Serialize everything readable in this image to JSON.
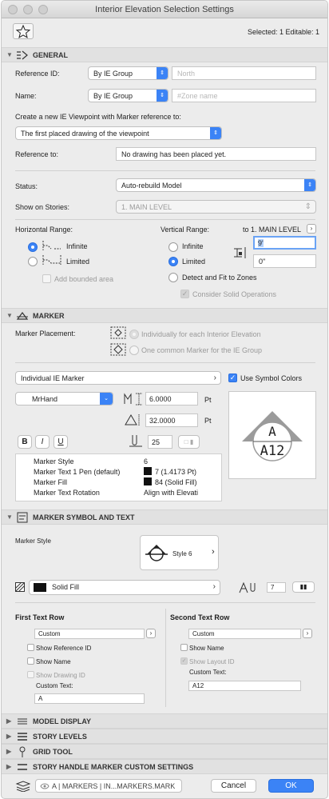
{
  "window": {
    "title": "Interior Elevation Selection Settings",
    "selected_info": "Selected: 1 Editable: 1"
  },
  "general": {
    "header": "GENERAL",
    "reference_id_label": "Reference ID:",
    "reference_id_value": "By IE Group",
    "reference_id_placeholder": "North",
    "name_label": "Name:",
    "name_value": "By IE Group",
    "name_placeholder": "#Zone name",
    "create_label": "Create a new IE Viewpoint with Marker reference to:",
    "create_value": "The first placed drawing of the viewpoint",
    "reference_to_label": "Reference to:",
    "reference_to_value": "No drawing has been placed yet.",
    "status_label": "Status:",
    "status_value": "Auto-rebuild Model",
    "stories_label": "Show on Stories:",
    "stories_value": "1. MAIN LEVEL",
    "hrange_label": "Horizontal Range:",
    "h_infinite": "Infinite",
    "h_limited": "Limited",
    "add_bounded": "Add bounded area",
    "vrange_label": "Vertical Range:",
    "to_level": "to 1. MAIN LEVEL",
    "v_infinite": "Infinite",
    "v_limited": "Limited",
    "v_top": "9'",
    "v_bottom": "0\"",
    "detect_fit": "Detect and Fit to Zones",
    "consider_solid": "Consider Solid Operations"
  },
  "marker": {
    "header": "MARKER",
    "placement_label": "Marker Placement:",
    "placement_opt1": "Individually for each Interior Elevation",
    "placement_opt2": "One common Marker for the IE Group",
    "marker_type": "Individual IE Marker",
    "use_symbol_colors": "Use Symbol Colors",
    "font": "MrHand",
    "size1": "6.0000",
    "size2": "32.0000",
    "unit": "Pt",
    "width_factor": "25",
    "bold": "B",
    "italic": "I",
    "underline": "U",
    "preview_letter": "A",
    "preview_number": "A12",
    "props": [
      {
        "name": "Marker Style",
        "value": "6"
      },
      {
        "name": "Marker Text 1 Pen (default)",
        "value": "7 (1.4173 Pt)"
      },
      {
        "name": "Marker Fill",
        "value": "84 (Solid Fill)"
      },
      {
        "name": "Marker Text Rotation",
        "value": "Align with Elevati"
      }
    ]
  },
  "marker_symbol": {
    "header": "MARKER SYMBOL AND TEXT",
    "style_label": "Marker Style",
    "style_value": "Style 6",
    "fill_value": "Solid Fill",
    "pen_value": "7",
    "first_row_label": "First Text Row",
    "first_row_value": "Custom",
    "show_ref_id": "Show Reference ID",
    "show_name": "Show Name",
    "show_drawing_id": "Show Drawing ID",
    "custom_text_label": "Custom Text:",
    "first_custom_text": "A",
    "second_row_label": "Second Text Row",
    "second_row_value": "Custom",
    "show_name2": "Show Name",
    "show_layout_id": "Show Layout ID",
    "custom_text_label2": "Custom Text:",
    "second_custom_text": "A12"
  },
  "collapsed_sections": [
    "MODEL DISPLAY",
    "STORY LEVELS",
    "GRID TOOL",
    "STORY HANDLE MARKER CUSTOM SETTINGS"
  ],
  "footer": {
    "layer": "A | MARKERS | IN...MARKERS.MARK",
    "cancel": "Cancel",
    "ok": "OK"
  }
}
